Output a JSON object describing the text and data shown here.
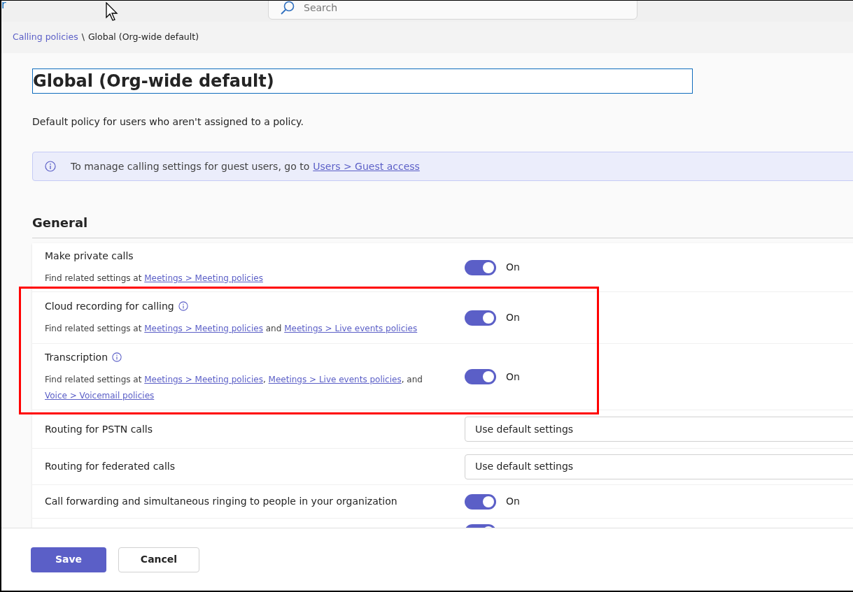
{
  "top_bar": {
    "app_title": "r",
    "search": {
      "placeholder": "Search"
    }
  },
  "breadcrumb": [
    {
      "label": "Calling policies",
      "kind": "link"
    },
    {
      "label": "\\",
      "kind": "text"
    },
    {
      "label": "Global (Org-wide default)",
      "kind": "text"
    }
  ],
  "policy_name": {
    "value": "Global (Org-wide default)"
  },
  "description": "Default policy for users who aren't assigned to a policy.",
  "info_banner": {
    "text": "To manage calling settings for guest users, go to",
    "link": "Users > Guest access"
  },
  "section_title": "General",
  "settings": [
    {
      "kind": "toggle",
      "label": "Make private calls",
      "info": false,
      "on": true,
      "state_label": "On",
      "description": [
        {
          "text": "Find related settings at",
          "kind": "text"
        },
        {
          "text": "Meetings > Meeting policies",
          "kind": "link"
        }
      ]
    },
    {
      "kind": "toggle",
      "label": "Cloud recording for calling",
      "info": true,
      "on": true,
      "state_label": "On",
      "description": [
        {
          "text": "Find related settings at",
          "kind": "text"
        },
        {
          "text": "Meetings > Meeting policies",
          "kind": "link"
        },
        {
          "text": "and",
          "kind": "text"
        },
        {
          "text": "Meetings > Live events policies",
          "kind": "link"
        }
      ]
    },
    {
      "kind": "toggle",
      "label": "Transcription",
      "info": true,
      "on": true,
      "state_label": "On",
      "description": [
        {
          "text": "Find related settings at",
          "kind": "text"
        },
        {
          "text": "Meetings > Meeting policies",
          "kind": "link"
        },
        {
          "text": ",",
          "kind": "text"
        },
        {
          "text": "Meetings > Live events policies",
          "kind": "link"
        },
        {
          "text": ", and",
          "kind": "text"
        },
        {
          "text": "Voice > Voicemail policies",
          "kind": "link"
        }
      ]
    },
    {
      "kind": "select",
      "label": "Routing for PSTN calls",
      "value": "Use default settings"
    },
    {
      "kind": "select",
      "label": "Routing for federated calls",
      "value": "Use default settings"
    },
    {
      "kind": "toggle",
      "label": "Call forwarding and simultaneous ringing to people in your organization",
      "info": false,
      "on": true,
      "state_label": "On"
    },
    {
      "kind": "toggle",
      "on": true
    }
  ],
  "buttons": [
    {
      "label": "Save",
      "kind": "primary"
    },
    {
      "label": "Cancel",
      "kind": "secondary"
    }
  ]
}
